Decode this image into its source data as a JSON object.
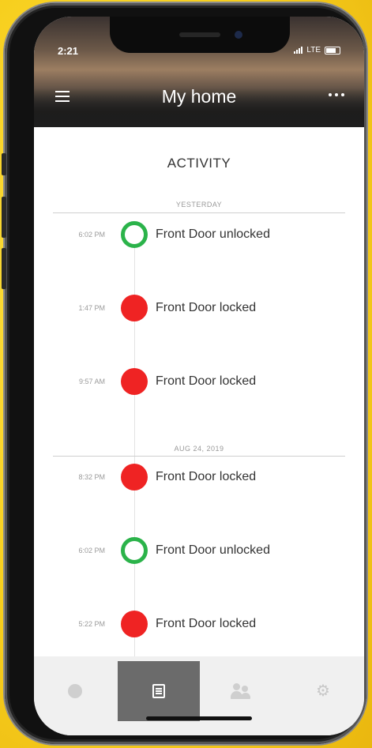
{
  "status_bar": {
    "time": "2:21",
    "network": "LTE"
  },
  "header": {
    "title": "My home"
  },
  "page": {
    "heading": "ACTIVITY"
  },
  "sections": [
    {
      "label": "YESTERDAY",
      "events": [
        {
          "time": "6:02 PM",
          "text": "Front Door unlocked",
          "state": "unlocked"
        },
        {
          "time": "1:47 PM",
          "text": "Front Door locked",
          "state": "locked"
        },
        {
          "time": "9:57 AM",
          "text": "Front Door locked",
          "state": "locked"
        }
      ]
    },
    {
      "label": "AUG 24, 2019",
      "events": [
        {
          "time": "8:32 PM",
          "text": "Front Door locked",
          "state": "locked"
        },
        {
          "time": "6:02 PM",
          "text": "Front Door unlocked",
          "state": "unlocked"
        },
        {
          "time": "5:22 PM",
          "text": "Front Door locked",
          "state": "locked"
        }
      ]
    }
  ],
  "tabs": [
    {
      "icon": "circle-icon",
      "active": false
    },
    {
      "icon": "list-icon",
      "active": true
    },
    {
      "icon": "users-icon",
      "active": false
    },
    {
      "icon": "gear-icon",
      "active": false
    }
  ],
  "colors": {
    "locked": "#ef2323",
    "unlocked": "#2bb34a",
    "background": "#f7cf1e"
  }
}
